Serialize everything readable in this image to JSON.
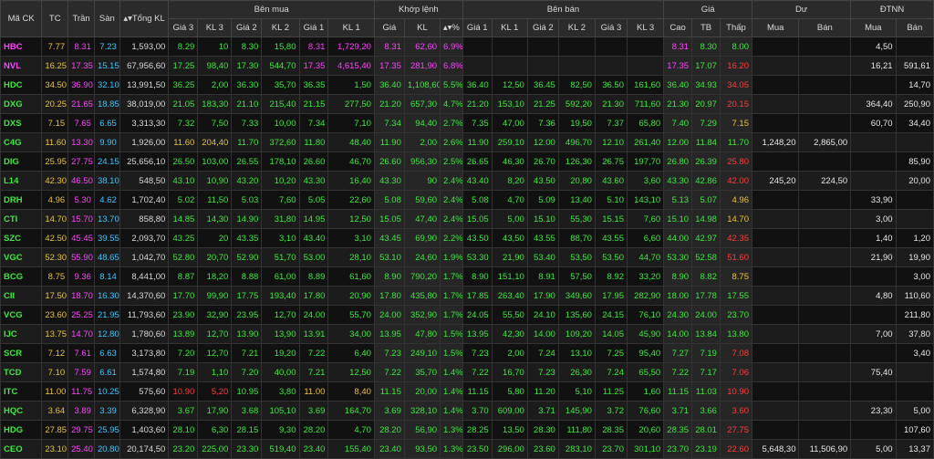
{
  "headers": {
    "code": "Mã CK",
    "ref": "TC",
    "ceil": "Trần",
    "floor": "Sàn",
    "total": "Tổng KL",
    "buy": "Bên mua",
    "match": "Khớp lệnh",
    "sell": "Bên bán",
    "price": "Giá",
    "dư": "Dư",
    "foreign": "ĐTNN",
    "p3": "Giá 3",
    "v3": "KL 3",
    "p2": "Giá 2",
    "v2": "KL 2",
    "p1": "Giá 1",
    "v1": "KL 1",
    "mp": "Giá",
    "mv": "KL",
    "pct": "%",
    "high": "Cao",
    "avg": "TB",
    "low": "Thấp",
    "d_buy": "Mua",
    "d_sell": "Bán",
    "f_buy": "Mua",
    "f_sell": "Bán",
    "sort_icon": "sort-arrows-icon"
  },
  "colors": {
    "up": "#3ee83e",
    "ceil": "#ff44ff",
    "floor": "#3cc6ff",
    "ref": "#e7c23a",
    "down": "#ff3c3c"
  },
  "rows": [
    {
      "code": "HBC",
      "cc": "ceilc",
      "ref": "7.77",
      "ceil": "8.31",
      "floor": "7.23",
      "total": "1,593,00",
      "b3p": "8.29",
      "b3v": "10",
      "b2p": "8.30",
      "b2v": "15,80",
      "b1p": "8.31",
      "b1v": "1,729,20",
      "bc": "ceilc",
      "b3c": "up",
      "mp": "8.31",
      "mv": "62,60",
      "pct": "6.9%",
      "mc": "ceilc",
      "s1p": "",
      "s1v": "",
      "s2p": "",
      "s2v": "",
      "s3p": "",
      "s3v": "",
      "sc": "up",
      "hi": "8.31",
      "hc": "ceilc",
      "av": "8.30",
      "ac": "up",
      "lo": "8.00",
      "lc": "up",
      "db": "",
      "ds": "",
      "fb": "4,50",
      "fs": ""
    },
    {
      "code": "NVL",
      "cc": "ceilc",
      "ref": "16.25",
      "ceil": "17.35",
      "floor": "15.15",
      "total": "67,956,60",
      "b3p": "17.25",
      "b3v": "98,40",
      "b2p": "17.30",
      "b2v": "544,70",
      "b1p": "17.35",
      "b1v": "4,615,40",
      "bc": "ceilc",
      "b3c": "up",
      "mp": "17.35",
      "mv": "281,90",
      "pct": "6.8%",
      "mc": "ceilc",
      "s1p": "",
      "s1v": "",
      "s2p": "",
      "s2v": "",
      "s3p": "",
      "s3v": "",
      "sc": "up",
      "hi": "17.35",
      "hc": "ceilc",
      "av": "17.07",
      "ac": "up",
      "lo": "16.20",
      "lc": "down",
      "db": "",
      "ds": "",
      "fb": "16,21",
      "fs": "591,61"
    },
    {
      "code": "HDC",
      "cc": "up",
      "ref": "34.50",
      "ceil": "36.90",
      "floor": "32.10",
      "total": "13,991,50",
      "b3p": "36.25",
      "b3v": "2,00",
      "b2p": "36.30",
      "b2v": "35,70",
      "b1p": "36.35",
      "b1v": "1,50",
      "bc": "up",
      "b3c": "up",
      "mp": "36.40",
      "mv": "1,108,60",
      "pct": "5.5%",
      "mc": "up",
      "s1p": "36.40",
      "s1v": "12,50",
      "s2p": "36.45",
      "s2v": "82,50",
      "s3p": "36.50",
      "s3v": "161,60",
      "sc": "up",
      "hi": "36.40",
      "hc": "up",
      "av": "34.93",
      "ac": "up",
      "lo": "34.05",
      "lc": "down",
      "db": "",
      "ds": "",
      "fb": "",
      "fs": "14,70"
    },
    {
      "code": "DXG",
      "cc": "up",
      "ref": "20.25",
      "ceil": "21.65",
      "floor": "18.85",
      "total": "38,019,00",
      "b3p": "21.05",
      "b3v": "183,30",
      "b2p": "21.10",
      "b2v": "215,40",
      "b1p": "21.15",
      "b1v": "277,50",
      "bc": "up",
      "b3c": "up",
      "mp": "21.20",
      "mv": "657,30",
      "pct": "4.7%",
      "mc": "up",
      "s1p": "21.20",
      "s1v": "153,10",
      "s2p": "21.25",
      "s2v": "592,20",
      "s3p": "21.30",
      "s3v": "711,60",
      "sc": "up",
      "hi": "21.30",
      "hc": "up",
      "av": "20.97",
      "ac": "up",
      "lo": "20.15",
      "lc": "down",
      "db": "",
      "ds": "",
      "fb": "364,40",
      "fs": "250,90"
    },
    {
      "code": "DXS",
      "cc": "up",
      "ref": "7.15",
      "ceil": "7.65",
      "floor": "6.65",
      "total": "3,313,30",
      "b3p": "7.32",
      "b3v": "7,50",
      "b2p": "7.33",
      "b2v": "10,00",
      "b1p": "7.34",
      "b1v": "7,10",
      "bc": "up",
      "b3c": "up",
      "mp": "7.34",
      "mv": "94,40",
      "pct": "2.7%",
      "mc": "up",
      "s1p": "7.35",
      "s1v": "47,00",
      "s2p": "7.36",
      "s2v": "19,50",
      "s3p": "7.37",
      "s3v": "65,80",
      "sc": "up",
      "hi": "7.40",
      "hc": "up",
      "av": "7.29",
      "ac": "up",
      "lo": "7.15",
      "lc": "refc",
      "db": "",
      "ds": "",
      "fb": "60,70",
      "fs": "34,40"
    },
    {
      "code": "C4G",
      "cc": "up",
      "ref": "11.60",
      "ceil": "13.30",
      "floor": "9.90",
      "total": "1,926,00",
      "b3p": "11.60",
      "b3v": "204,40",
      "b2p": "11.70",
      "b2v": "372,60",
      "b1p": "11.80",
      "b1v": "48,40",
      "bc": "up",
      "b3c": "refc",
      "mp": "11.90",
      "mv": "2,00",
      "pct": "2.6%",
      "mc": "up",
      "s1p": "11.90",
      "s1v": "259,10",
      "s2p": "12.00",
      "s2v": "496,70",
      "s3p": "12.10",
      "s3v": "261,40",
      "sc": "up",
      "hi": "12.00",
      "hc": "up",
      "av": "11.84",
      "ac": "up",
      "lo": "11.70",
      "lc": "up",
      "db": "1,248,20",
      "ds": "2,865,00",
      "fb": "",
      "fs": ""
    },
    {
      "code": "DIG",
      "cc": "up",
      "ref": "25.95",
      "ceil": "27.75",
      "floor": "24.15",
      "total": "25,656,10",
      "b3p": "26.50",
      "b3v": "103,00",
      "b2p": "26.55",
      "b2v": "178,10",
      "b1p": "26.60",
      "b1v": "46,70",
      "bc": "up",
      "b3c": "up",
      "mp": "26.60",
      "mv": "956,30",
      "pct": "2.5%",
      "mc": "up",
      "s1p": "26.65",
      "s1v": "46,30",
      "s2p": "26.70",
      "s2v": "126,30",
      "s3p": "26.75",
      "s3v": "197,70",
      "sc": "up",
      "hi": "26.80",
      "hc": "up",
      "av": "26.39",
      "ac": "up",
      "lo": "25.80",
      "lc": "down",
      "db": "",
      "ds": "",
      "fb": "",
      "fs": "85,90"
    },
    {
      "code": "L14",
      "cc": "up",
      "ref": "42.30",
      "ceil": "46.50",
      "floor": "38.10",
      "total": "548,50",
      "b3p": "43.10",
      "b3v": "10,90",
      "b2p": "43.20",
      "b2v": "10,20",
      "b1p": "43.30",
      "b1v": "16,40",
      "bc": "up",
      "b3c": "up",
      "mp": "43.30",
      "mv": "90",
      "pct": "2.4%",
      "mc": "up",
      "s1p": "43.40",
      "s1v": "8,20",
      "s2p": "43.50",
      "s2v": "20,80",
      "s3p": "43.60",
      "s3v": "3,60",
      "sc": "up",
      "hi": "43.30",
      "hc": "up",
      "av": "42.86",
      "ac": "up",
      "lo": "42.00",
      "lc": "down",
      "db": "245,20",
      "ds": "224,50",
      "fb": "",
      "fs": "20,00"
    },
    {
      "code": "DRH",
      "cc": "up",
      "ref": "4.96",
      "ceil": "5.30",
      "floor": "4.62",
      "total": "1,702,40",
      "b3p": "5.02",
      "b3v": "11,50",
      "b2p": "5.03",
      "b2v": "7,60",
      "b1p": "5.05",
      "b1v": "22,60",
      "bc": "up",
      "b3c": "up",
      "mp": "5.08",
      "mv": "59,60",
      "pct": "2.4%",
      "mc": "up",
      "s1p": "5.08",
      "s1v": "4,70",
      "s2p": "5.09",
      "s2v": "13,40",
      "s3p": "5.10",
      "s3v": "143,10",
      "sc": "up",
      "hi": "5.13",
      "hc": "up",
      "av": "5.07",
      "ac": "up",
      "lo": "4.96",
      "lc": "refc",
      "db": "",
      "ds": "",
      "fb": "33,90",
      "fs": ""
    },
    {
      "code": "CTI",
      "cc": "up",
      "ref": "14.70",
      "ceil": "15.70",
      "floor": "13.70",
      "total": "858,80",
      "b3p": "14.85",
      "b3v": "14,30",
      "b2p": "14.90",
      "b2v": "31,80",
      "b1p": "14.95",
      "b1v": "12,50",
      "bc": "up",
      "b3c": "up",
      "mp": "15.05",
      "mv": "47,40",
      "pct": "2.4%",
      "mc": "up",
      "s1p": "15.05",
      "s1v": "5,00",
      "s2p": "15.10",
      "s2v": "55,30",
      "s3p": "15.15",
      "s3v": "7,60",
      "sc": "up",
      "hi": "15.10",
      "hc": "up",
      "av": "14.98",
      "ac": "up",
      "lo": "14.70",
      "lc": "refc",
      "db": "",
      "ds": "",
      "fb": "3,00",
      "fs": ""
    },
    {
      "code": "SZC",
      "cc": "up",
      "ref": "42.50",
      "ceil": "45.45",
      "floor": "39.55",
      "total": "2,093,70",
      "b3p": "43.25",
      "b3v": "20",
      "b2p": "43.35",
      "b2v": "3,10",
      "b1p": "43.40",
      "b1v": "3,10",
      "bc": "up",
      "b3c": "up",
      "mp": "43.45",
      "mv": "69,90",
      "pct": "2.2%",
      "mc": "up",
      "s1p": "43.50",
      "s1v": "43,50",
      "s2p": "43.55",
      "s2v": "88,70",
      "s3p": "43.55",
      "s3v": "6,60",
      "sc": "up",
      "hi": "44.00",
      "hc": "up",
      "av": "42.97",
      "ac": "up",
      "lo": "42.35",
      "lc": "down",
      "db": "",
      "ds": "",
      "fb": "1,40",
      "fs": "1,20"
    },
    {
      "code": "VGC",
      "cc": "up",
      "ref": "52.30",
      "ceil": "55.90",
      "floor": "48.65",
      "total": "1,042,70",
      "b3p": "52.80",
      "b3v": "20,70",
      "b2p": "52.90",
      "b2v": "51,70",
      "b1p": "53.00",
      "b1v": "28,10",
      "bc": "up",
      "b3c": "up",
      "mp": "53.10",
      "mv": "24,60",
      "pct": "1.9%",
      "mc": "up",
      "s1p": "53.30",
      "s1v": "21,90",
      "s2p": "53.40",
      "s2v": "53,50",
      "s3p": "53.50",
      "s3v": "44,70",
      "sc": "up",
      "hi": "53.30",
      "hc": "up",
      "av": "52.58",
      "ac": "up",
      "lo": "51.60",
      "lc": "down",
      "db": "",
      "ds": "",
      "fb": "21,90",
      "fs": "19,90"
    },
    {
      "code": "BCG",
      "cc": "up",
      "ref": "8.75",
      "ceil": "9.36",
      "floor": "8.14",
      "total": "8,441,00",
      "b3p": "8.87",
      "b3v": "18,20",
      "b2p": "8.88",
      "b2v": "61,00",
      "b1p": "8.89",
      "b1v": "61,60",
      "bc": "up",
      "b3c": "up",
      "mp": "8.90",
      "mv": "790,20",
      "pct": "1.7%",
      "mc": "up",
      "s1p": "8.90",
      "s1v": "151,10",
      "s2p": "8.91",
      "s2v": "57,50",
      "s3p": "8.92",
      "s3v": "33,20",
      "sc": "up",
      "hi": "8.90",
      "hc": "up",
      "av": "8.82",
      "ac": "up",
      "lo": "8.75",
      "lc": "refc",
      "db": "",
      "ds": "",
      "fb": "",
      "fs": "3,00"
    },
    {
      "code": "CII",
      "cc": "up",
      "ref": "17.50",
      "ceil": "18.70",
      "floor": "16.30",
      "total": "14,370,60",
      "b3p": "17.70",
      "b3v": "99,90",
      "b2p": "17.75",
      "b2v": "193,40",
      "b1p": "17.80",
      "b1v": "20,90",
      "bc": "up",
      "b3c": "up",
      "mp": "17.80",
      "mv": "435,80",
      "pct": "1.7%",
      "mc": "up",
      "s1p": "17.85",
      "s1v": "263,40",
      "s2p": "17.90",
      "s2v": "349,60",
      "s3p": "17.95",
      "s3v": "282,90",
      "sc": "up",
      "hi": "18.00",
      "hc": "up",
      "av": "17.78",
      "ac": "up",
      "lo": "17.55",
      "lc": "up",
      "db": "",
      "ds": "",
      "fb": "4,80",
      "fs": "110,60"
    },
    {
      "code": "VCG",
      "cc": "up",
      "ref": "23.60",
      "ceil": "25.25",
      "floor": "21.95",
      "total": "11,793,60",
      "b3p": "23.90",
      "b3v": "32,90",
      "b2p": "23.95",
      "b2v": "12,70",
      "b1p": "24.00",
      "b1v": "55,70",
      "bc": "up",
      "b3c": "up",
      "mp": "24.00",
      "mv": "352,90",
      "pct": "1.7%",
      "mc": "up",
      "s1p": "24.05",
      "s1v": "55,50",
      "s2p": "24.10",
      "s2v": "135,60",
      "s3p": "24.15",
      "s3v": "76,10",
      "sc": "up",
      "hi": "24.30",
      "hc": "up",
      "av": "24.00",
      "ac": "up",
      "lo": "23.70",
      "lc": "up",
      "db": "",
      "ds": "",
      "fb": "",
      "fs": "211,80"
    },
    {
      "code": "IJC",
      "cc": "up",
      "ref": "13.75",
      "ceil": "14.70",
      "floor": "12.80",
      "total": "1,780,60",
      "b3p": "13.89",
      "b3v": "12,70",
      "b2p": "13.90",
      "b2v": "13,90",
      "b1p": "13.91",
      "b1v": "34,00",
      "bc": "up",
      "b3c": "up",
      "mp": "13.95",
      "mv": "47,80",
      "pct": "1.5%",
      "mc": "up",
      "s1p": "13.95",
      "s1v": "42,30",
      "s2p": "14.00",
      "s2v": "109,20",
      "s3p": "14.05",
      "s3v": "45,90",
      "sc": "up",
      "hi": "14.00",
      "hc": "up",
      "av": "13.84",
      "ac": "up",
      "lo": "13.80",
      "lc": "up",
      "db": "",
      "ds": "",
      "fb": "7,00",
      "fs": "37,80"
    },
    {
      "code": "SCR",
      "cc": "up",
      "ref": "7.12",
      "ceil": "7.61",
      "floor": "6.63",
      "total": "3,173,80",
      "b3p": "7.20",
      "b3v": "12,70",
      "b2p": "7.21",
      "b2v": "19,20",
      "b1p": "7.22",
      "b1v": "6,40",
      "bc": "up",
      "b3c": "up",
      "mp": "7.23",
      "mv": "249,10",
      "pct": "1.5%",
      "mc": "up",
      "s1p": "7.23",
      "s1v": "2,00",
      "s2p": "7.24",
      "s2v": "13,10",
      "s3p": "7.25",
      "s3v": "95,40",
      "sc": "up",
      "hi": "7.27",
      "hc": "up",
      "av": "7.19",
      "ac": "up",
      "lo": "7.08",
      "lc": "down",
      "db": "",
      "ds": "",
      "fb": "",
      "fs": "3,40"
    },
    {
      "code": "TCD",
      "cc": "up",
      "ref": "7.10",
      "ceil": "7.59",
      "floor": "6.61",
      "total": "1,574,80",
      "b3p": "7.19",
      "b3v": "1,10",
      "b2p": "7.20",
      "b2v": "40,00",
      "b1p": "7.21",
      "b1v": "12,50",
      "bc": "up",
      "b3c": "up",
      "mp": "7.22",
      "mv": "35,70",
      "pct": "1.4%",
      "mc": "up",
      "s1p": "7.22",
      "s1v": "16,70",
      "s2p": "7.23",
      "s2v": "26,30",
      "s3p": "7.24",
      "s3v": "65,50",
      "sc": "up",
      "hi": "7.22",
      "hc": "up",
      "av": "7.17",
      "ac": "up",
      "lo": "7.06",
      "lc": "down",
      "db": "",
      "ds": "",
      "fb": "75,40",
      "fs": ""
    },
    {
      "code": "ITC",
      "cc": "up",
      "ref": "11.00",
      "ceil": "11.75",
      "floor": "10.25",
      "total": "575,60",
      "b3p": "10.90",
      "b3v": "5,20",
      "b2p": "10.95",
      "b2v": "3,80",
      "b1p": "11.00",
      "b1v": "8,40",
      "bc": "refc",
      "b3c": "down",
      "mp": "11.15",
      "mv": "20,00",
      "pct": "1.4%",
      "mc": "up",
      "s1p": "11.15",
      "s1v": "5,80",
      "s2p": "11.20",
      "s2v": "5,10",
      "s3p": "11.25",
      "s3v": "1,60",
      "sc": "up",
      "hi": "11.15",
      "hc": "up",
      "av": "11.03",
      "ac": "up",
      "lo": "10.90",
      "lc": "down",
      "db": "",
      "ds": "",
      "fb": "",
      "fs": ""
    },
    {
      "code": "HQC",
      "cc": "up",
      "ref": "3.64",
      "ceil": "3.89",
      "floor": "3.39",
      "total": "6,328,90",
      "b3p": "3.67",
      "b3v": "17,90",
      "b2p": "3.68",
      "b2v": "105,10",
      "b1p": "3.69",
      "b1v": "164,70",
      "bc": "up",
      "b3c": "up",
      "mp": "3.69",
      "mv": "328,10",
      "pct": "1.4%",
      "mc": "up",
      "s1p": "3.70",
      "s1v": "609,00",
      "s2p": "3.71",
      "s2v": "145,90",
      "s3p": "3.72",
      "s3v": "76,60",
      "sc": "up",
      "hi": "3.71",
      "hc": "up",
      "av": "3.66",
      "ac": "up",
      "lo": "3.60",
      "lc": "down",
      "db": "",
      "ds": "",
      "fb": "23,30",
      "fs": "5,00"
    },
    {
      "code": "HDG",
      "cc": "up",
      "ref": "27.85",
      "ceil": "29.75",
      "floor": "25.95",
      "total": "1,403,60",
      "b3p": "28.10",
      "b3v": "6,30",
      "b2p": "28.15",
      "b2v": "9,30",
      "b1p": "28.20",
      "b1v": "4,70",
      "bc": "up",
      "b3c": "up",
      "mp": "28.20",
      "mv": "56,90",
      "pct": "1.3%",
      "mc": "up",
      "s1p": "28.25",
      "s1v": "13,50",
      "s2p": "28.30",
      "s2v": "111,80",
      "s3p": "28.35",
      "s3v": "20,60",
      "sc": "up",
      "hi": "28.35",
      "hc": "up",
      "av": "28.01",
      "ac": "up",
      "lo": "27.75",
      "lc": "down",
      "db": "",
      "ds": "",
      "fb": "",
      "fs": "107,60"
    },
    {
      "code": "CEO",
      "cc": "up",
      "ref": "23.10",
      "ceil": "25.40",
      "floor": "20.80",
      "total": "20,174,50",
      "b3p": "23.20",
      "b3v": "225,00",
      "b2p": "23.30",
      "b2v": "519,40",
      "b1p": "23.40",
      "b1v": "155,40",
      "bc": "up",
      "b3c": "up",
      "mp": "23.40",
      "mv": "93,50",
      "pct": "1.3%",
      "mc": "up",
      "s1p": "23.50",
      "s1v": "296,00",
      "s2p": "23.60",
      "s2v": "283,10",
      "s3p": "23.70",
      "s3v": "301,10",
      "sc": "up",
      "hi": "23.70",
      "hc": "up",
      "av": "23.19",
      "ac": "up",
      "lo": "22.60",
      "lc": "down",
      "db": "5,648,30",
      "ds": "11,506,90",
      "fb": "5,00",
      "fs": "13,37"
    }
  ]
}
